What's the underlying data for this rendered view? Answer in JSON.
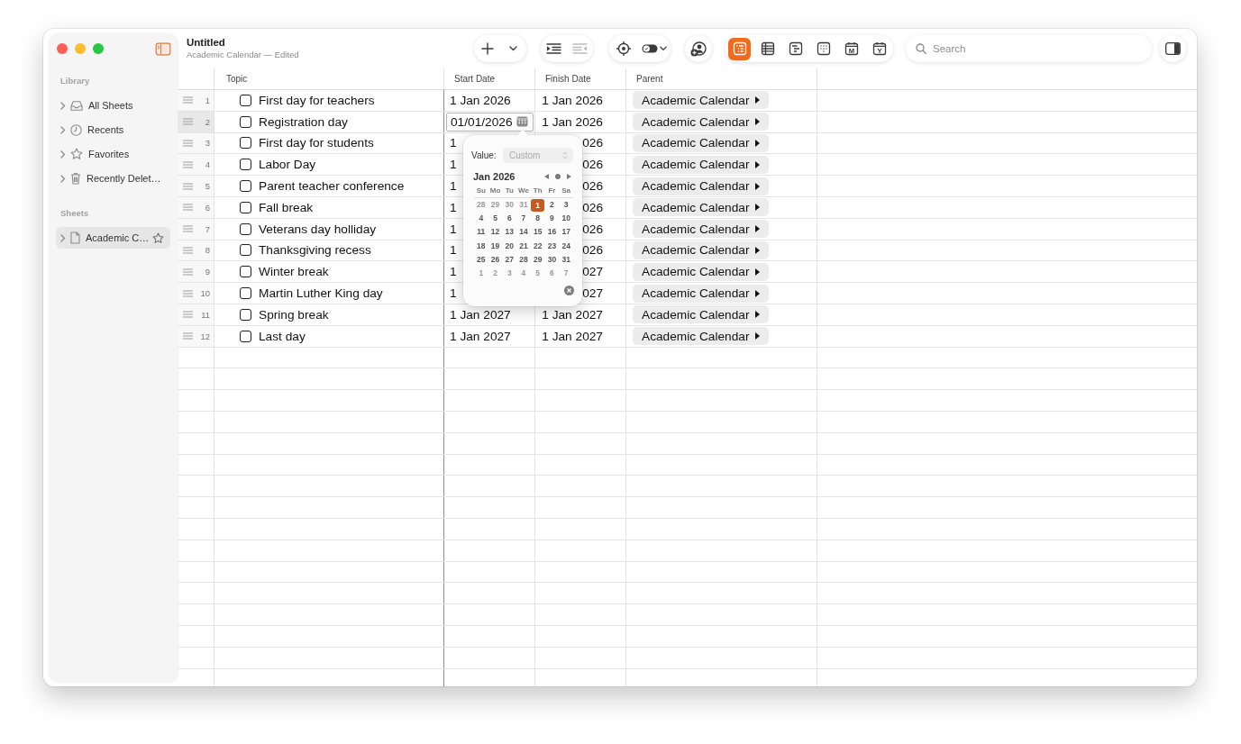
{
  "window": {
    "title": "Untitled",
    "subtitle": "Academic Calendar — Edited"
  },
  "sidebar": {
    "sections": [
      {
        "title": "Library",
        "items": [
          {
            "kind": "inbox",
            "label": "All Sheets",
            "expanded": false,
            "selected": false
          },
          {
            "kind": "recents",
            "label": "Recents",
            "expanded": false,
            "selected": false
          },
          {
            "kind": "favorites",
            "label": "Favorites",
            "expanded": false,
            "selected": false
          },
          {
            "kind": "trash",
            "label": "Recently Delet…",
            "expanded": false,
            "selected": false
          }
        ]
      },
      {
        "title": "Sheets",
        "items": [
          {
            "kind": "sheet",
            "label": "Academic C…",
            "expanded": false,
            "selected": true,
            "favorite": false
          }
        ]
      }
    ]
  },
  "toolbar": {
    "groups": [
      {
        "buttons": [
          {
            "kind": "add",
            "disabled": false
          },
          {
            "kind": "add-menu",
            "disabled": false
          }
        ]
      },
      {
        "buttons": [
          {
            "kind": "indent",
            "disabled": false
          },
          {
            "kind": "outdent",
            "disabled": true
          }
        ]
      },
      {
        "buttons": [
          {
            "kind": "focus",
            "disabled": false
          },
          {
            "kind": "toggle-menu",
            "disabled": false
          }
        ]
      },
      {
        "buttons": [
          {
            "kind": "share",
            "disabled": false
          }
        ]
      }
    ],
    "views": [
      {
        "kind": "outline",
        "selected": true
      },
      {
        "kind": "table",
        "selected": false
      },
      {
        "kind": "timeline",
        "selected": false
      },
      {
        "kind": "board",
        "selected": false
      },
      {
        "kind": "month",
        "letter": "M",
        "selected": false
      },
      {
        "kind": "year",
        "letter": "Y",
        "selected": false
      }
    ],
    "search": {
      "placeholder": "Search"
    }
  },
  "table": {
    "columns": [
      "Topic",
      "Start Date",
      "Finish Date",
      "Parent"
    ],
    "rows": [
      {
        "number": "1",
        "selected": false,
        "checked": false,
        "topic": "First day for teachers",
        "start_date": "1 Jan 2026",
        "editing": false,
        "finish_date": "1 Jan 2026",
        "parent": "Academic Calendar"
      },
      {
        "number": "2",
        "selected": true,
        "checked": false,
        "topic": "Registration day",
        "start_date": "01/01/2026",
        "editing": true,
        "finish_date": "1 Jan 2026",
        "parent": "Academic Calendar"
      },
      {
        "number": "3",
        "selected": false,
        "checked": false,
        "topic": "First day for students",
        "start_date": "1",
        "editing": false,
        "finish_date": "026",
        "parent": "Academic Calendar"
      },
      {
        "number": "4",
        "selected": false,
        "checked": false,
        "topic": "Labor Day",
        "start_date": "1",
        "editing": false,
        "finish_date": "026",
        "parent": "Academic Calendar"
      },
      {
        "number": "5",
        "selected": false,
        "checked": false,
        "topic": "Parent teacher conference",
        "start_date": "1",
        "editing": false,
        "finish_date": "026",
        "parent": "Academic Calendar"
      },
      {
        "number": "6",
        "selected": false,
        "checked": false,
        "topic": "Fall break",
        "start_date": "1",
        "editing": false,
        "finish_date": "026",
        "parent": "Academic Calendar"
      },
      {
        "number": "7",
        "selected": false,
        "checked": false,
        "topic": "Veterans day holliday",
        "start_date": "1",
        "editing": false,
        "finish_date": "026",
        "parent": "Academic Calendar"
      },
      {
        "number": "8",
        "selected": false,
        "checked": false,
        "topic": "Thanksgiving recess",
        "start_date": "1",
        "editing": false,
        "finish_date": "026",
        "parent": "Academic Calendar"
      },
      {
        "number": "9",
        "selected": false,
        "checked": false,
        "topic": "Winter break",
        "start_date": "1",
        "editing": false,
        "finish_date": "027",
        "parent": "Academic Calendar"
      },
      {
        "number": "10",
        "selected": false,
        "checked": false,
        "topic": "Martin Luther King day",
        "start_date": "1",
        "editing": false,
        "finish_date": "027",
        "parent": "Academic Calendar"
      },
      {
        "number": "11",
        "selected": false,
        "checked": false,
        "topic": "Spring break",
        "start_date": "1 Jan 2027",
        "editing": false,
        "finish_date": "1 Jan 2027",
        "parent": "Academic Calendar"
      },
      {
        "number": "12",
        "selected": false,
        "checked": false,
        "topic": "Last day",
        "start_date": "1 Jan 2027",
        "editing": false,
        "finish_date": "1 Jan 2027",
        "parent": "Academic Calendar"
      }
    ]
  },
  "date_picker": {
    "value_label": "Value:",
    "value": "Custom",
    "value_disabled": true,
    "month": "Jan 2026",
    "weekdays": [
      "Su",
      "Mo",
      "Tu",
      "We",
      "Th",
      "Fr",
      "Sa"
    ],
    "days": [
      {
        "label": "28",
        "outside": true,
        "selected": false
      },
      {
        "label": "29",
        "outside": true,
        "selected": false
      },
      {
        "label": "30",
        "outside": true,
        "selected": false
      },
      {
        "label": "31",
        "outside": true,
        "selected": false
      },
      {
        "label": "1",
        "outside": false,
        "selected": true
      },
      {
        "label": "2",
        "outside": false,
        "selected": false
      },
      {
        "label": "3",
        "outside": false,
        "selected": false
      },
      {
        "label": "4",
        "outside": false,
        "selected": false
      },
      {
        "label": "5",
        "outside": false,
        "selected": false
      },
      {
        "label": "6",
        "outside": false,
        "selected": false
      },
      {
        "label": "7",
        "outside": false,
        "selected": false
      },
      {
        "label": "8",
        "outside": false,
        "selected": false
      },
      {
        "label": "9",
        "outside": false,
        "selected": false
      },
      {
        "label": "10",
        "outside": false,
        "selected": false
      },
      {
        "label": "11",
        "outside": false,
        "selected": false
      },
      {
        "label": "12",
        "outside": false,
        "selected": false
      },
      {
        "label": "13",
        "outside": false,
        "selected": false
      },
      {
        "label": "14",
        "outside": false,
        "selected": false
      },
      {
        "label": "15",
        "outside": false,
        "selected": false
      },
      {
        "label": "16",
        "outside": false,
        "selected": false
      },
      {
        "label": "17",
        "outside": false,
        "selected": false
      },
      {
        "label": "18",
        "outside": false,
        "selected": false
      },
      {
        "label": "19",
        "outside": false,
        "selected": false
      },
      {
        "label": "20",
        "outside": false,
        "selected": false
      },
      {
        "label": "21",
        "outside": false,
        "selected": false
      },
      {
        "label": "22",
        "outside": false,
        "selected": false
      },
      {
        "label": "23",
        "outside": false,
        "selected": false
      },
      {
        "label": "24",
        "outside": false,
        "selected": false
      },
      {
        "label": "25",
        "outside": false,
        "selected": false
      },
      {
        "label": "26",
        "outside": false,
        "selected": false
      },
      {
        "label": "27",
        "outside": false,
        "selected": false
      },
      {
        "label": "28",
        "outside": false,
        "selected": false
      },
      {
        "label": "29",
        "outside": false,
        "selected": false
      },
      {
        "label": "30",
        "outside": false,
        "selected": false
      },
      {
        "label": "31",
        "outside": false,
        "selected": false
      },
      {
        "label": "1",
        "outside": true,
        "selected": false
      },
      {
        "label": "2",
        "outside": true,
        "selected": false
      },
      {
        "label": "3",
        "outside": true,
        "selected": false
      },
      {
        "label": "4",
        "outside": true,
        "selected": false
      },
      {
        "label": "5",
        "outside": true,
        "selected": false
      },
      {
        "label": "6",
        "outside": true,
        "selected": false
      },
      {
        "label": "7",
        "outside": true,
        "selected": false
      }
    ]
  }
}
